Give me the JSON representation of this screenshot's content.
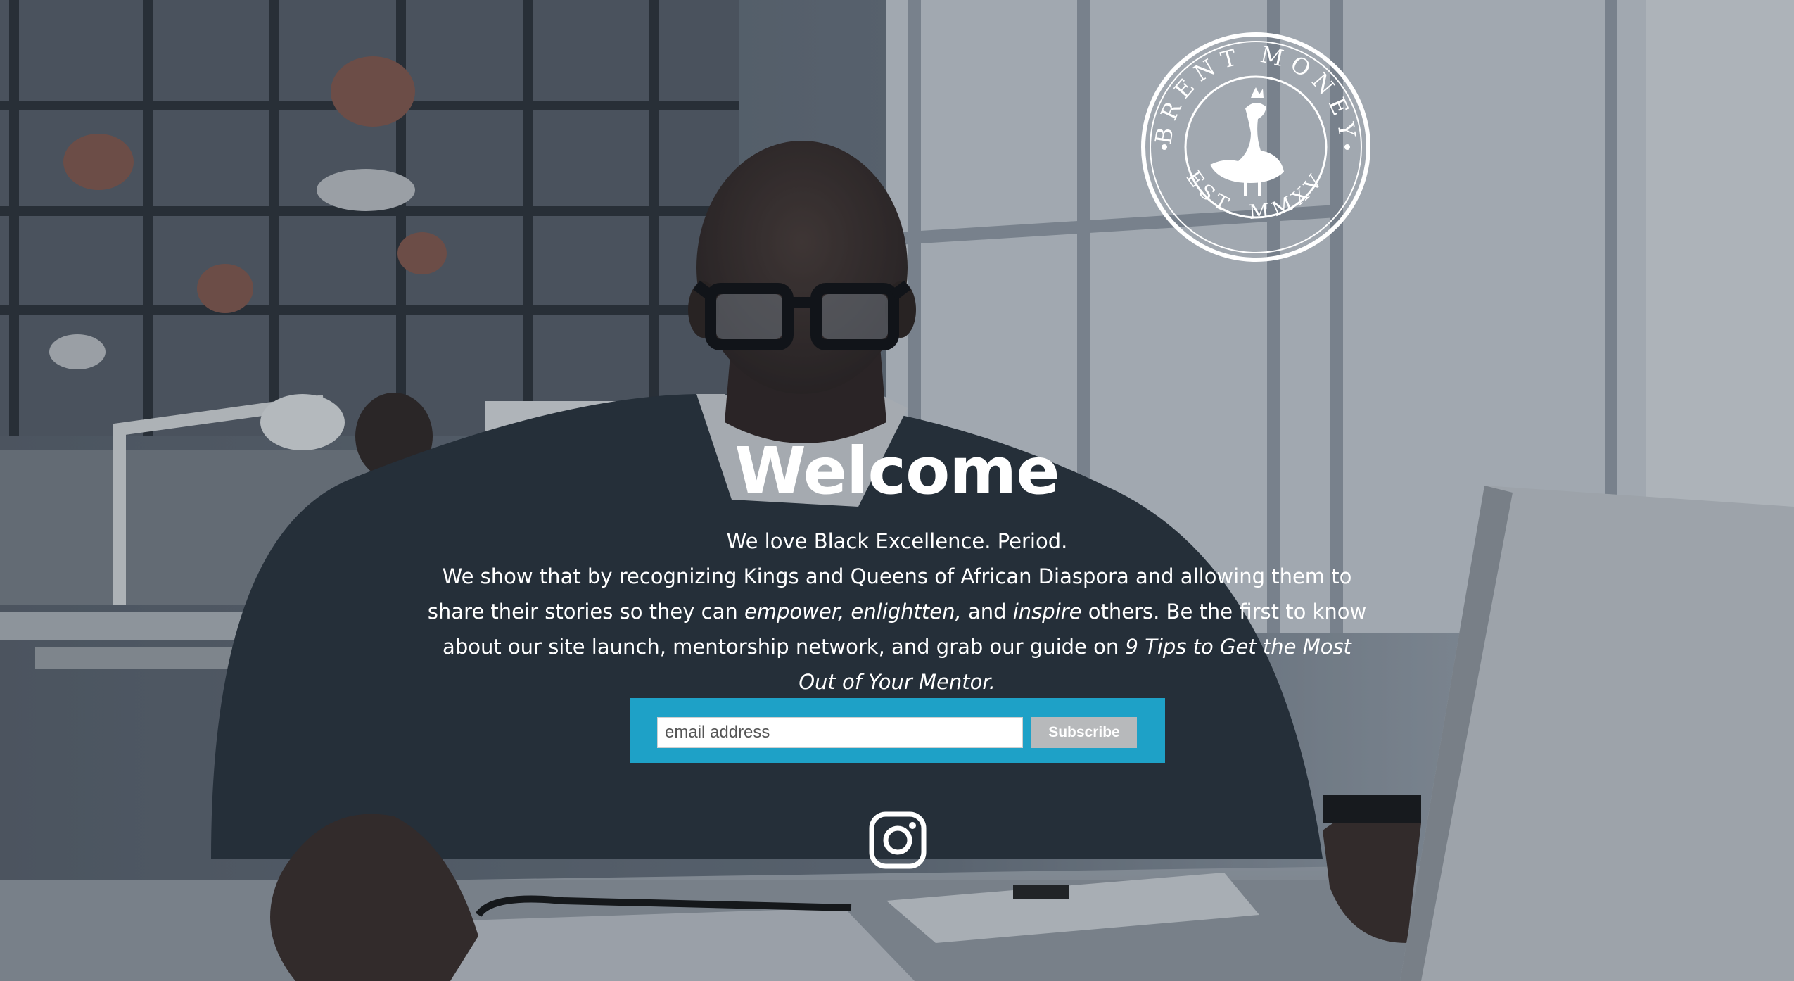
{
  "logo": {
    "ring_text_top": "BRENT MONEY",
    "ring_text_bottom": "EST. MMXV",
    "emblem": "peacock-emblem"
  },
  "hero": {
    "title": "Welcome",
    "tagline": "We love Black Excellence. Period.",
    "description_part1": "We show that by recognizing Kings and Queens of African Diaspora and allowing them to share their stories so they can ",
    "em1": "empower, enlightten,",
    "description_part2": " and ",
    "em2": "inspire",
    "description_part3": " others. Be the first to know about our site launch, mentorship network, and grab our guide on ",
    "em3": "9 Tips to Get the Most Out of Your Mentor.",
    "colors": {
      "accent": "#1ea1c7",
      "button": "#b7b9bb",
      "text": "#ffffff"
    }
  },
  "signup": {
    "email_placeholder": "email address",
    "email_value": "",
    "subscribe_label": "Subscribe"
  },
  "social": {
    "icon": "instagram-icon"
  }
}
